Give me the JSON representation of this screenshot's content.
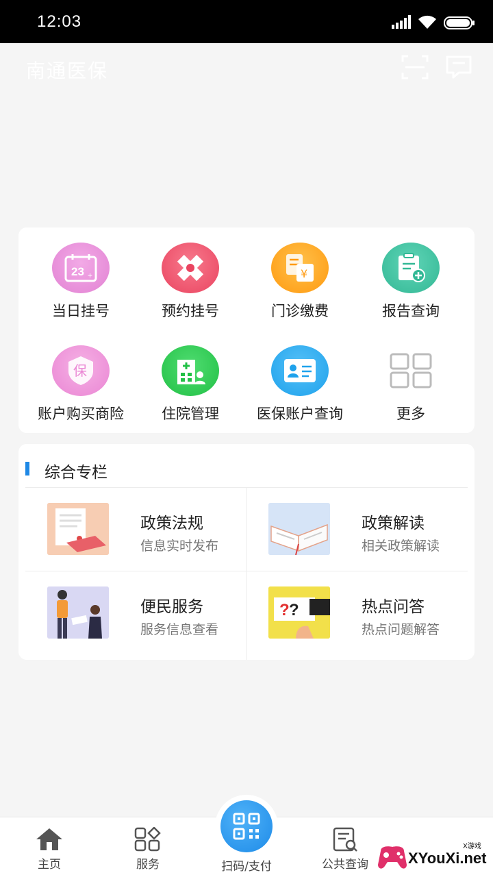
{
  "status_bar": {
    "time": "12:03"
  },
  "header": {
    "title": "南通医保",
    "scan_icon": "scan-icon",
    "message_icon": "message-icon"
  },
  "services": [
    {
      "label": "当日挂号",
      "icon": "calendar-icon",
      "color": "#e98fd8"
    },
    {
      "label": "预约挂号",
      "icon": "medical-cross-icon",
      "color": "#f0566d"
    },
    {
      "label": "门诊缴费",
      "icon": "payment-doc-icon",
      "color": "#ffaa22"
    },
    {
      "label": "报告查询",
      "icon": "report-icon",
      "color": "#3fc4a5"
    },
    {
      "label": "账户购买商险",
      "icon": "insurance-shield-icon",
      "color": "#f094d6"
    },
    {
      "label": "住院管理",
      "icon": "hospital-icon",
      "color": "#2fcf55"
    },
    {
      "label": "医保账户查询",
      "icon": "id-card-icon",
      "color": "#2eaaf0"
    },
    {
      "label": "更多",
      "icon": "grid-more-icon",
      "color": "#bbbbbb"
    }
  ],
  "column": {
    "title": "综合专栏",
    "items": [
      {
        "name": "政策法规",
        "desc": "信息实时发布"
      },
      {
        "name": "政策解读",
        "desc": "相关政策解读"
      },
      {
        "name": "便民服务",
        "desc": "服务信息查看"
      },
      {
        "name": "热点问答",
        "desc": "热点问题解答"
      }
    ]
  },
  "tabbar": {
    "home": "主页",
    "services": "服务",
    "scan_pay": "扫码/支付",
    "public_query": "公共查询"
  },
  "watermark": {
    "text": "XYouXi.net",
    "small": "X游戏"
  }
}
